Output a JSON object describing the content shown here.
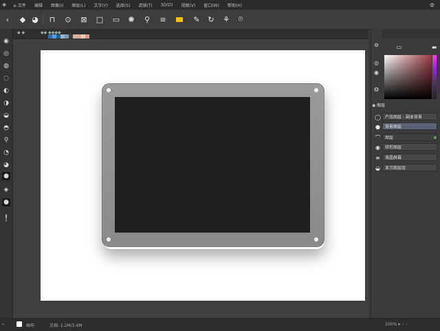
{
  "menubar": {
    "items": [
      "≡ 文件",
      "编辑",
      "图像(I)",
      "图层(L)",
      "文字(Y)",
      "选择(S)",
      "滤镜(T)",
      "3D(D)",
      "视图(V)",
      "窗口(W)",
      "帮助(H)"
    ],
    "right_icon": "⚙"
  },
  "statusbar": {
    "doc_label": "画布",
    "info": "文档: 1.2M/3.4M",
    "right_info": "100% ▾ ◦ ◦"
  },
  "layers": {
    "header": "图层",
    "rows": [
      "产品图层 - 副本背景",
      "背景图层",
      "图层",
      "矩形图层",
      "液晶屏幕"
    ],
    "bottom_row": "显示图层组"
  },
  "doc_tabs": [
    "◆ ◆",
    "◆◆ ◆◆◆◆"
  ],
  "swatches": [
    "#2e6ea8",
    "#5a9bd4",
    "#1f5f97",
    "#9fb4c8",
    "#7a9ab8",
    "#3c3c3c",
    "#c6b9aa",
    "#e2a79f",
    "#f0c9b4",
    "#d99b8c"
  ],
  "colors": {
    "canvas_bg": "#404040",
    "artboard": "#ffffff",
    "frame": "#8e8e8e",
    "screen": "#1f1f1f",
    "selected_layer": "#5b6274"
  }
}
